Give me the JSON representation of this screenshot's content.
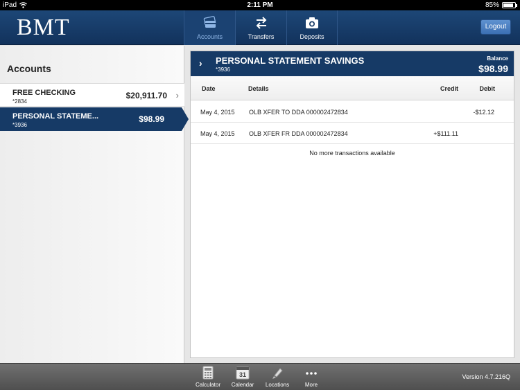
{
  "status_bar": {
    "device": "iPad",
    "time": "2:11 PM",
    "battery": "85%",
    "battery_level": 0.85
  },
  "header": {
    "logo": "BMT",
    "tabs": [
      {
        "label": "Accounts",
        "icon": "accounts-card-icon",
        "active": true
      },
      {
        "label": "Transfers",
        "icon": "transfer-arrows-icon",
        "active": false
      },
      {
        "label": "Deposits",
        "icon": "camera-icon",
        "active": false
      }
    ],
    "logout_label": "Logout"
  },
  "sidebar": {
    "title": "Accounts",
    "accounts": [
      {
        "name": "FREE CHECKING",
        "number": "*2834",
        "balance": "$20,911.70",
        "selected": false
      },
      {
        "name": "PERSONAL STATEME...",
        "number": "*3936",
        "balance": "$98.99",
        "selected": true
      }
    ]
  },
  "detail": {
    "title": "PERSONAL STATEMENT SAVINGS",
    "number": "*3936",
    "balance_label": "Balance",
    "balance": "$98.99",
    "columns": [
      "Date",
      "Details",
      "Credit",
      "Debit"
    ],
    "transactions": [
      {
        "date": "May 4, 2015",
        "details": "OLB XFER TO DDA 000002472834",
        "credit": "",
        "debit": "-$12.12"
      },
      {
        "date": "May 4, 2015",
        "details": "OLB XFER FR DDA 000002472834",
        "credit": "+$111.11",
        "debit": ""
      }
    ],
    "footer_note": "No more transactions available"
  },
  "bottom_bar": {
    "items": [
      {
        "label": "Calculator",
        "icon": "calculator-icon"
      },
      {
        "label": "Calendar",
        "icon": "calendar-icon",
        "icon_text": "31"
      },
      {
        "label": "Locations",
        "icon": "location-pin-icon"
      },
      {
        "label": "More",
        "icon": "more-dots-icon"
      }
    ],
    "version": "Version 4.7.216Q"
  },
  "colors": {
    "brand_navy": "#163a66",
    "header_blue": "#1d4777",
    "logout_blue": "#4a80c4"
  }
}
